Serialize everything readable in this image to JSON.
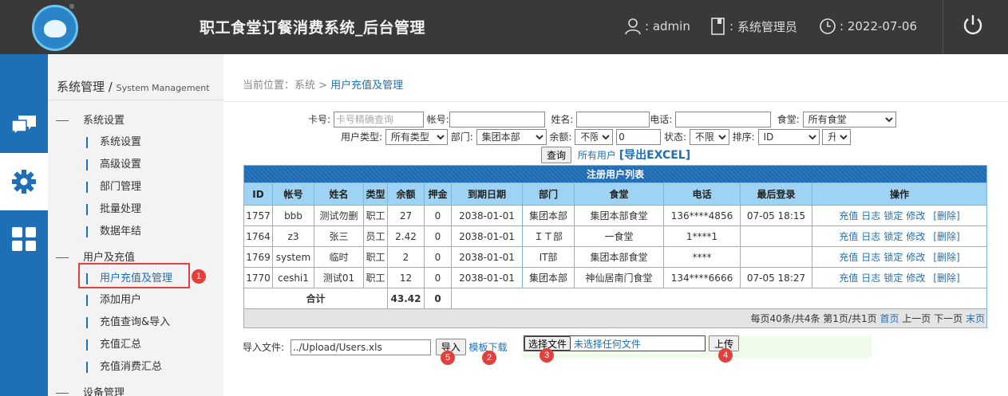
{
  "header": {
    "app_title": "职工食堂订餐消费系统_后台管理",
    "user_label": "admin",
    "role_label": "系统管理员",
    "date_label": "2022-07-06"
  },
  "sidebar": {
    "title": "系统管理",
    "title_en": "System Management",
    "groups": [
      {
        "label": "系统设置",
        "items": [
          "系统设置",
          "高级设置",
          "部门管理",
          "批量处理",
          "数据年结"
        ]
      },
      {
        "label": "用户及充值",
        "items": [
          "用户充值及管理",
          "添加用户",
          "充值查询&导入",
          "充值汇总",
          "充值消费汇总"
        ]
      },
      {
        "label": "设备管理",
        "items": []
      }
    ]
  },
  "breadcrumb": {
    "prefix": "当前位置：系统 > ",
    "current": "用户充值及管理"
  },
  "filters": {
    "card_label": "卡号:",
    "card_placeholder": "卡号精确查询",
    "account_label": "帐号:",
    "name_label": "姓名:",
    "phone_label": "电话:",
    "canteen_label": "食堂:",
    "canteen_value": "所有食堂",
    "usertype_label": "用户类型:",
    "usertype_value": "所有类型",
    "dept_label": "部门:",
    "dept_value": "集团本部",
    "balance_label": "余额:",
    "balance_op": "不限",
    "balance_value": "0",
    "status_label": "状态:",
    "status_value": "不限",
    "sort_label": "排序:",
    "sort_field": "ID",
    "sort_dir": "升",
    "query_button": "查询",
    "all_users_link": "所有用户",
    "export_link": "[导出EXCEL]"
  },
  "table": {
    "caption": "注册用户列表",
    "columns": [
      "ID",
      "帐号",
      "姓名",
      "类型",
      "余额",
      "押金",
      "到期日期",
      "部门",
      "食堂",
      "电话",
      "最后登录",
      "操作"
    ],
    "rows": [
      [
        "1757",
        "bbb",
        "测试勿删",
        "职工",
        "27",
        "0",
        "2038-01-01",
        "集团本部",
        "集团本部食堂",
        "136****4856",
        "07-05 18:15"
      ],
      [
        "1764",
        "z3",
        "张三",
        "员工",
        "2.42",
        "0",
        "2038-01-01",
        "ＩＴ部",
        "一食堂",
        "1****1",
        ""
      ],
      [
        "1769",
        "system",
        "临时",
        "职工",
        "2",
        "0",
        "2038-01-01",
        "IT部",
        "集团本部食堂",
        "****",
        ""
      ],
      [
        "1770",
        "ceshi1",
        "测试01",
        "职工",
        "12",
        "0",
        "2038-01-01",
        "集团本部",
        "神仙居南门食堂",
        "134****6666",
        "07-05 18:27"
      ]
    ],
    "ops": [
      "充值",
      "日志",
      "锁定",
      "修改",
      "[删除]"
    ],
    "total_label": "合计",
    "total_balance": "43.42",
    "total_deposit": "0",
    "pager_text": "每页40条/共4条 第1页/共1页",
    "pager_first": "首页",
    "pager_prev": "上一页",
    "pager_next": "下一页",
    "pager_last": "末页"
  },
  "import": {
    "label": "导入文件:",
    "path": "../Upload/Users.xls",
    "import_button": "导入",
    "template_link": "模板下载",
    "choose_button": "选择文件",
    "no_file_text": "未选择任何文件",
    "upload_button": "上传"
  },
  "badges": [
    "1",
    "2",
    "3",
    "4",
    "5"
  ]
}
